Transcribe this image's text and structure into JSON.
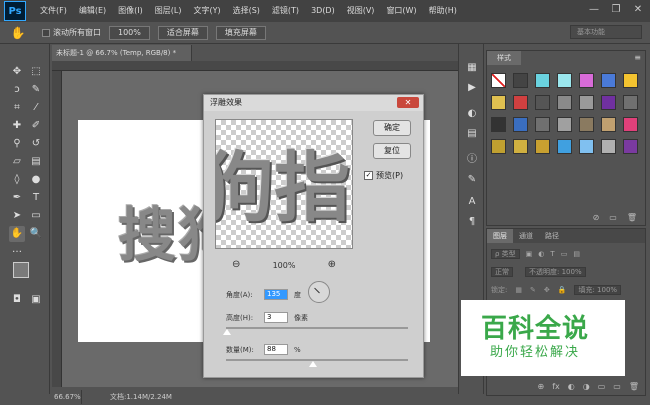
{
  "app": {
    "logo": "Ps"
  },
  "menu": [
    "文件(F)",
    "编辑(E)",
    "图像(I)",
    "图层(L)",
    "文字(Y)",
    "选择(S)",
    "滤镜(T)",
    "3D(D)",
    "视图(V)",
    "窗口(W)",
    "帮助(H)"
  ],
  "window_controls": {
    "minimize": "—",
    "restore": "❐",
    "close": "✕"
  },
  "options_bar": {
    "scroll_all_label": "滚动所有窗口",
    "zoom_100": "100%",
    "fit_screen": "适合屏幕",
    "fill_screen": "填充屏幕",
    "workspace": "基本功能"
  },
  "document": {
    "tab_title": "未标题-1 @ 66.7% (Temp, RGB/8) *",
    "canvas_text": "搜狗",
    "status_zoom": "66.67%",
    "status_doc": "文档:1.14M/2.24M"
  },
  "dialog": {
    "title": "浮雕效果",
    "preview_text": "狗指",
    "zoom_level": "100%",
    "ok_label": "确定",
    "reset_label": "复位",
    "preview_label": "预览(P)",
    "preview_checked": "✓",
    "angle_label": "角度(A):",
    "angle_value": "135",
    "angle_unit": "度",
    "height_label": "高度(H):",
    "height_value": "3",
    "height_unit": "像素",
    "amount_label": "数量(M):",
    "amount_value": "88",
    "amount_unit": "%"
  },
  "styles_panel": {
    "tab": "样式",
    "menu_icon": "≡",
    "swatch_colors": [
      "#ffffff",
      "#444444",
      "#6ad3e0",
      "#9be7ee",
      "#d86bd8",
      "#4a7ad8",
      "#f4c430",
      "#e0c050",
      "#d04040",
      "#555555",
      "#8a8a8a",
      "#9a9a9a",
      "#7030a0",
      "#707070",
      "#333333",
      "#3a6ec0",
      "#707070",
      "#a0a0a0",
      "#8a7a60",
      "#c0a070",
      "#e0407a",
      "#c0a030",
      "#d0b040",
      "#c8a030",
      "#40a0e0",
      "#80c0f0",
      "#b0b0b0",
      "#7a3aa0"
    ],
    "footer_icons": [
      "⊘",
      "▭",
      "🗑"
    ]
  },
  "layers_panel": {
    "tabs": [
      "图层",
      "通道",
      "路径"
    ],
    "kind_label": "ρ 类型",
    "blend_mode": "正常",
    "opacity_label": "不透明度: 100%",
    "lock_label": "锁定:",
    "fill_label": "填充: 100%",
    "footer_icons": [
      "⊕",
      "fx",
      "◐",
      "◑",
      "▭",
      "▭",
      "🗑"
    ]
  },
  "watermark": {
    "title": "百科全说",
    "subtitle": "助你轻松解决"
  }
}
